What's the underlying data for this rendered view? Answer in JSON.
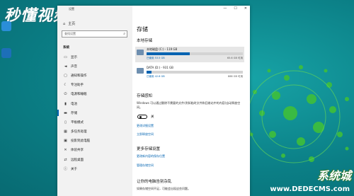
{
  "watermark": {
    "top": "秒懂视频",
    "bottom": "系统城",
    "bottom_cn": "装机系统",
    "bottom_url": "www.DEDECMS.com"
  },
  "window": {
    "title": "设置",
    "controls": {
      "minimize": "—",
      "maximize": "☐",
      "close": "✕"
    }
  },
  "sidebar": {
    "home": "主页",
    "search_placeholder": "查找设置",
    "section": "系统",
    "items": [
      {
        "label": "显示",
        "icon": "display-icon"
      },
      {
        "label": "声音",
        "icon": "sound-icon"
      },
      {
        "label": "通知和操作",
        "icon": "notification-icon"
      },
      {
        "label": "专注助手",
        "icon": "focus-icon"
      },
      {
        "label": "电源和睡眠",
        "icon": "power-icon"
      },
      {
        "label": "电池",
        "icon": "battery-icon"
      },
      {
        "label": "存储",
        "icon": "storage-icon",
        "active": true
      },
      {
        "label": "平板模式",
        "icon": "tablet-icon"
      },
      {
        "label": "多任务处理",
        "icon": "multitask-icon"
      },
      {
        "label": "投影到此电脑",
        "icon": "project-icon"
      },
      {
        "label": "体验共享",
        "icon": "share-icon"
      },
      {
        "label": "远程桌面",
        "icon": "remote-icon"
      },
      {
        "label": "关于",
        "icon": "info-icon"
      }
    ]
  },
  "main": {
    "title": "存储",
    "local_storage": "本地存储",
    "drives": [
      {
        "name": "本地磁盘 (C:) - 119 GB",
        "used": "已使用 53.5 GB",
        "free": "65.6 GB 可用",
        "percent": 45
      },
      {
        "name": "DATA (D:) - 931 GB",
        "used": "已使用 42.6 GB",
        "free": "888 GB 可用",
        "percent": 5
      }
    ],
    "storage_sense_title": "存储感知",
    "storage_sense_desc": "Windows 可以通过删除不需要的文件(例如临时文件和回收站中的内容)自动释放空间。",
    "toggle_label": "关",
    "link_configure": "更改详细设置",
    "link_free_now": "立即释放空间",
    "more_title": "更多存储设置",
    "link_save_location": "更改新内容的保存位置",
    "link_manage_spaces": "管理存储空间",
    "bottom_title": "让你的电脑告别杂乱",
    "bottom_desc": "如果存储空间不足，可能会出现这些问题。"
  }
}
